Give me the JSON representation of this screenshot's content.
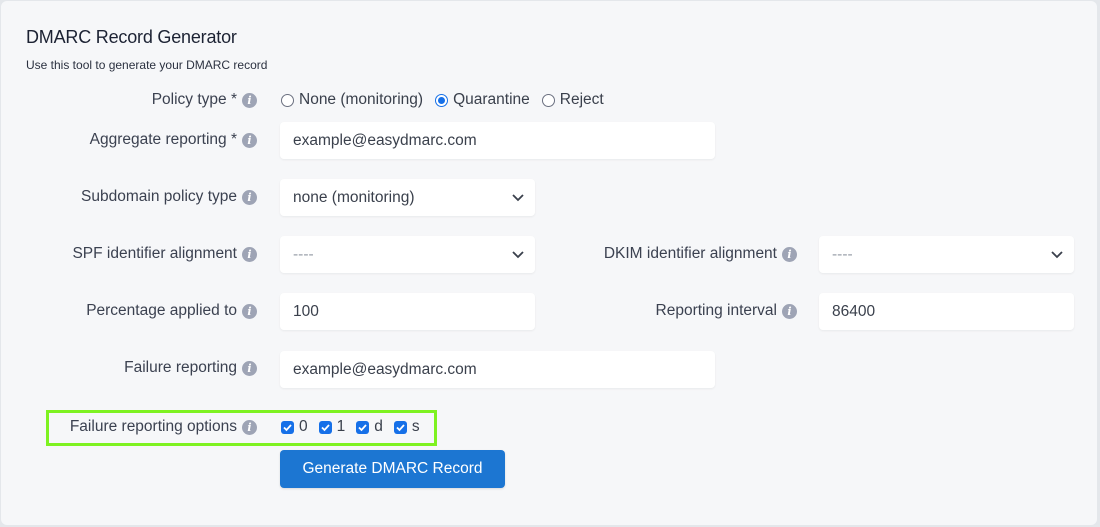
{
  "header": {
    "title": "DMARC Record Generator",
    "subtitle": "Use this tool to generate your DMARC record"
  },
  "form": {
    "policy_type": {
      "label": "Policy type *",
      "options": [
        {
          "label": "None (monitoring)",
          "selected": false
        },
        {
          "label": "Quarantine",
          "selected": true
        },
        {
          "label": "Reject",
          "selected": false
        }
      ]
    },
    "aggregate_reporting": {
      "label": "Aggregate reporting *",
      "value": "example@easydmarc.com"
    },
    "subdomain_policy": {
      "label": "Subdomain policy type",
      "value": "none (monitoring)"
    },
    "spf_alignment": {
      "label": "SPF identifier alignment",
      "value": "----"
    },
    "dkim_alignment": {
      "label": "DKIM identifier alignment",
      "value": "----"
    },
    "percentage": {
      "label": "Percentage applied to",
      "value": "100"
    },
    "reporting_interval": {
      "label": "Reporting interval",
      "value": "86400"
    },
    "failure_reporting": {
      "label": "Failure reporting",
      "value": "example@easydmarc.com"
    },
    "failure_options": {
      "label": "Failure reporting options",
      "options": [
        {
          "label": "0",
          "checked": true
        },
        {
          "label": "1",
          "checked": true
        },
        {
          "label": "d",
          "checked": true
        },
        {
          "label": "s",
          "checked": true
        }
      ]
    },
    "submit_label": "Generate DMARC Record"
  },
  "icons": {
    "info": "i"
  },
  "colors": {
    "accent": "#1670e8",
    "button": "#1c76d2",
    "highlight": "#7ef221"
  }
}
